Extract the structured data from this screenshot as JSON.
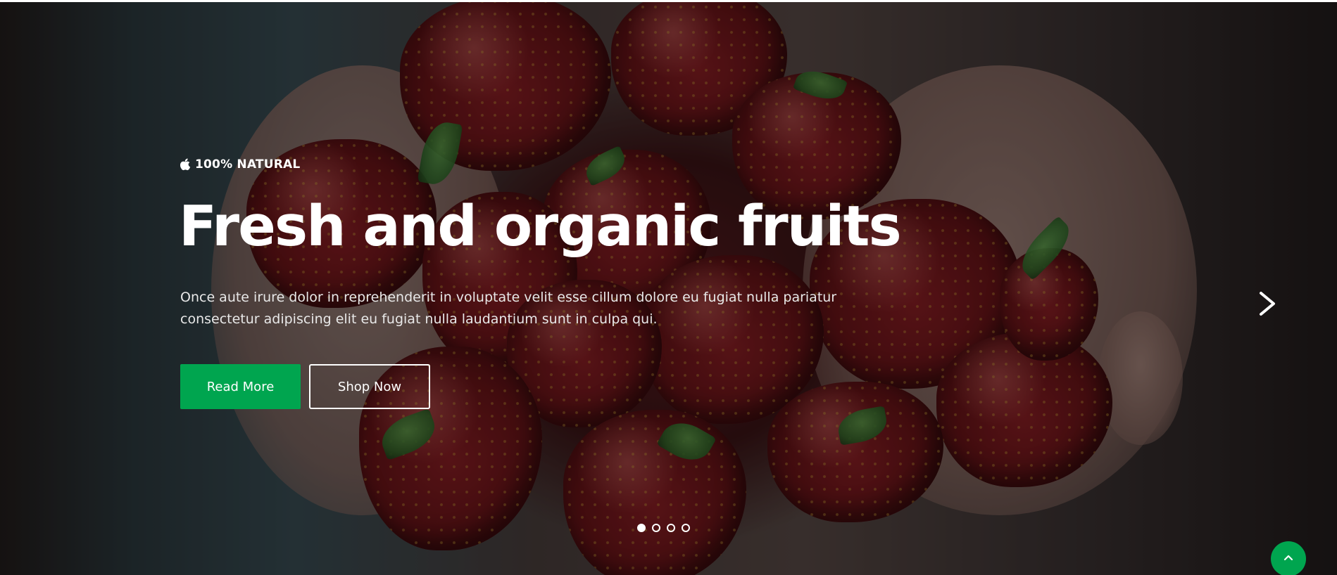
{
  "hero": {
    "tagline": "100% NATURAL",
    "tagline_icon": "apple-icon",
    "headline": "Fresh and organic fruits",
    "description": "Once aute irure dolor in reprehenderit in voluptate velit esse cillum dolore eu fugiat nulla pariatur consectetur adipiscing elit eu fugiat nulla laudantium sunt in culpa qui.",
    "primary_button_label": "Read More",
    "secondary_button_label": "Shop Now",
    "background_image": "strawberries held in cupped hands"
  },
  "slider": {
    "next_icon": "chevron-right-icon",
    "dot_count": 4,
    "active_index": 0
  },
  "back_to_top": {
    "icon": "chevron-up-icon"
  },
  "colors": {
    "accent": "#00a54f",
    "text": "#ffffff",
    "overlay": "rgba(0,0,0,0.38)"
  }
}
